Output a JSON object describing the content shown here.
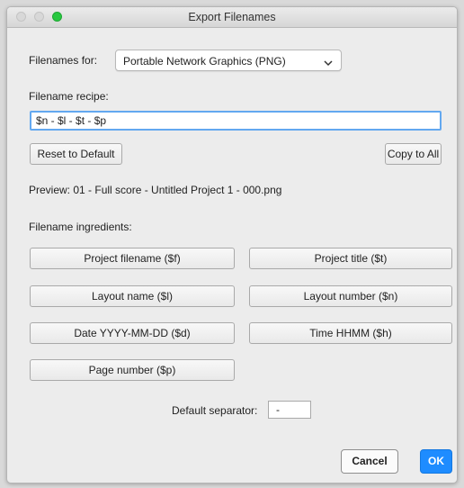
{
  "window": {
    "title": "Export Filenames"
  },
  "filenames_for": {
    "label": "Filenames for:",
    "selected": "Portable Network Graphics (PNG)"
  },
  "recipe": {
    "label": "Filename recipe:",
    "value": "$n - $l - $t - $p"
  },
  "buttons": {
    "reset": "Reset to Default",
    "copy_all": "Copy to All",
    "cancel": "Cancel",
    "ok": "OK"
  },
  "preview": "Preview: 01 - Full score - Untitled Project 1 - 000.png",
  "ingredients": {
    "label": "Filename ingredients:",
    "items": [
      "Project filename ($f)",
      "Project title ($t)",
      "Layout name ($l)",
      "Layout number ($n)",
      "Date YYYY-MM-DD ($d)",
      "Time HHMM ($h)",
      "Page number ($p)"
    ]
  },
  "separator": {
    "label": "Default separator:",
    "value": "-"
  },
  "colors": {
    "accent": "#1e8cff",
    "focus_ring": "#63a8f0",
    "green_light": "#28c840"
  }
}
